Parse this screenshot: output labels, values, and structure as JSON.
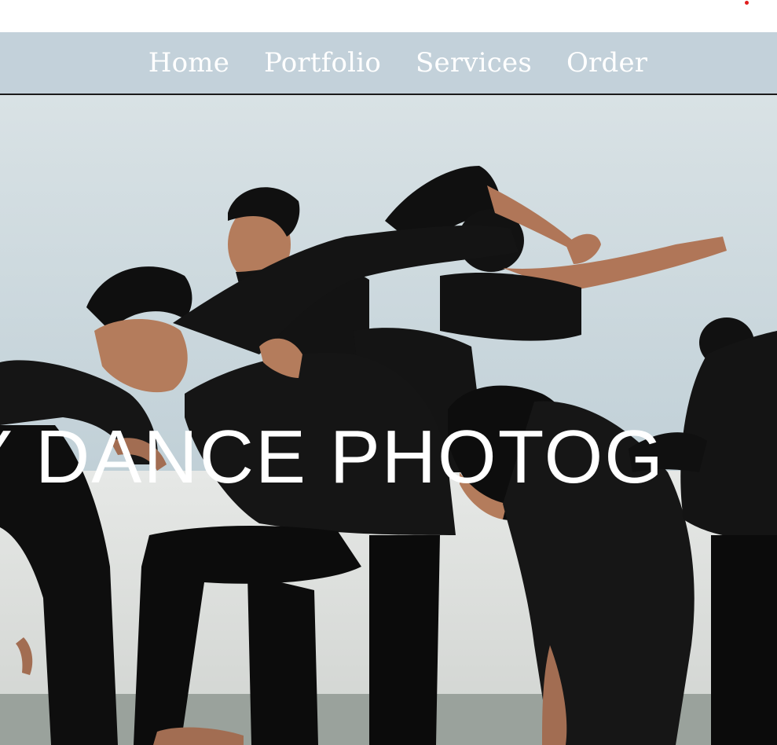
{
  "nav": {
    "items": [
      {
        "label": "Home"
      },
      {
        "label": "Portfolio"
      },
      {
        "label": "Services"
      },
      {
        "label": "Order"
      }
    ]
  },
  "hero": {
    "headline": "Y DANCE PHOTOG",
    "image": "dancers-in-black-on-rooftop"
  },
  "colors": {
    "nav_background": "#c3d1da",
    "nav_text": "#ffffff",
    "headline_text": "#ffffff",
    "indicator_dot": "#e11d1d"
  }
}
